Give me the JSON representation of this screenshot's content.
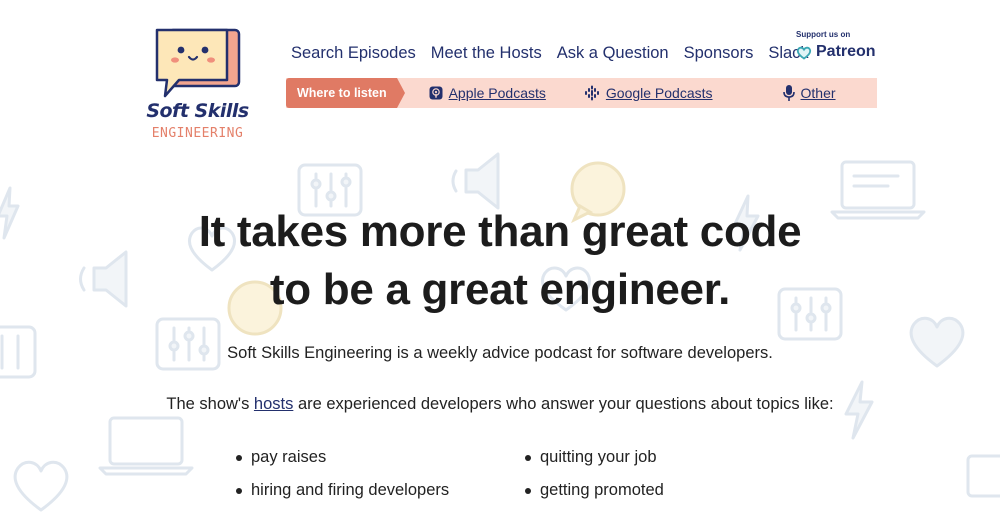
{
  "logo": {
    "title": "Soft Skills",
    "subtitle": "ENGINEERING"
  },
  "nav": {
    "items": [
      "Search Episodes",
      "Meet the Hosts",
      "Ask a Question",
      "Sponsors",
      "Slack"
    ],
    "patreon": {
      "support_label": "Support us on",
      "label": "Patreon"
    }
  },
  "listen": {
    "tag": "Where to listen",
    "apple": "Apple Podcasts",
    "google": "Google Podcasts",
    "other": "Other"
  },
  "hero": {
    "line1": "It takes more than great code",
    "line2": "to be a great engineer.",
    "sub1": "Soft Skills Engineering is a weekly advice podcast for software developers.",
    "sub2_before": "The show's ",
    "sub2_link": "hosts",
    "sub2_after": " are experienced developers who answer your questions about topics like:"
  },
  "topics": {
    "left": [
      "pay raises",
      "hiring and firing developers"
    ],
    "right": [
      "quitting your job",
      "getting promoted"
    ]
  },
  "colors": {
    "navy": "#23306d",
    "coral": "#e07a64",
    "peach": "#fbd9cf"
  }
}
